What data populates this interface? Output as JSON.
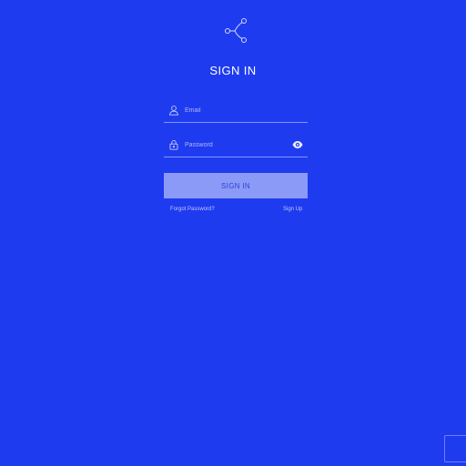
{
  "header": {
    "title": "SIGN IN",
    "logo_icon": "share-nodes-icon"
  },
  "form": {
    "email": {
      "placeholder": "Email",
      "value": "",
      "icon": "user-icon"
    },
    "password": {
      "placeholder": "Password",
      "value": "",
      "icon": "lock-icon",
      "toggle_icon": "eye-icon"
    },
    "submit_label": "SIGN IN"
  },
  "links": {
    "forgot_password": "Forgot Password?",
    "sign_up": "Sign Up"
  },
  "colors": {
    "background": "#1f3bf0",
    "button_bg": "#8b9af6",
    "button_text": "#2e44d8",
    "text": "#ffffff"
  }
}
